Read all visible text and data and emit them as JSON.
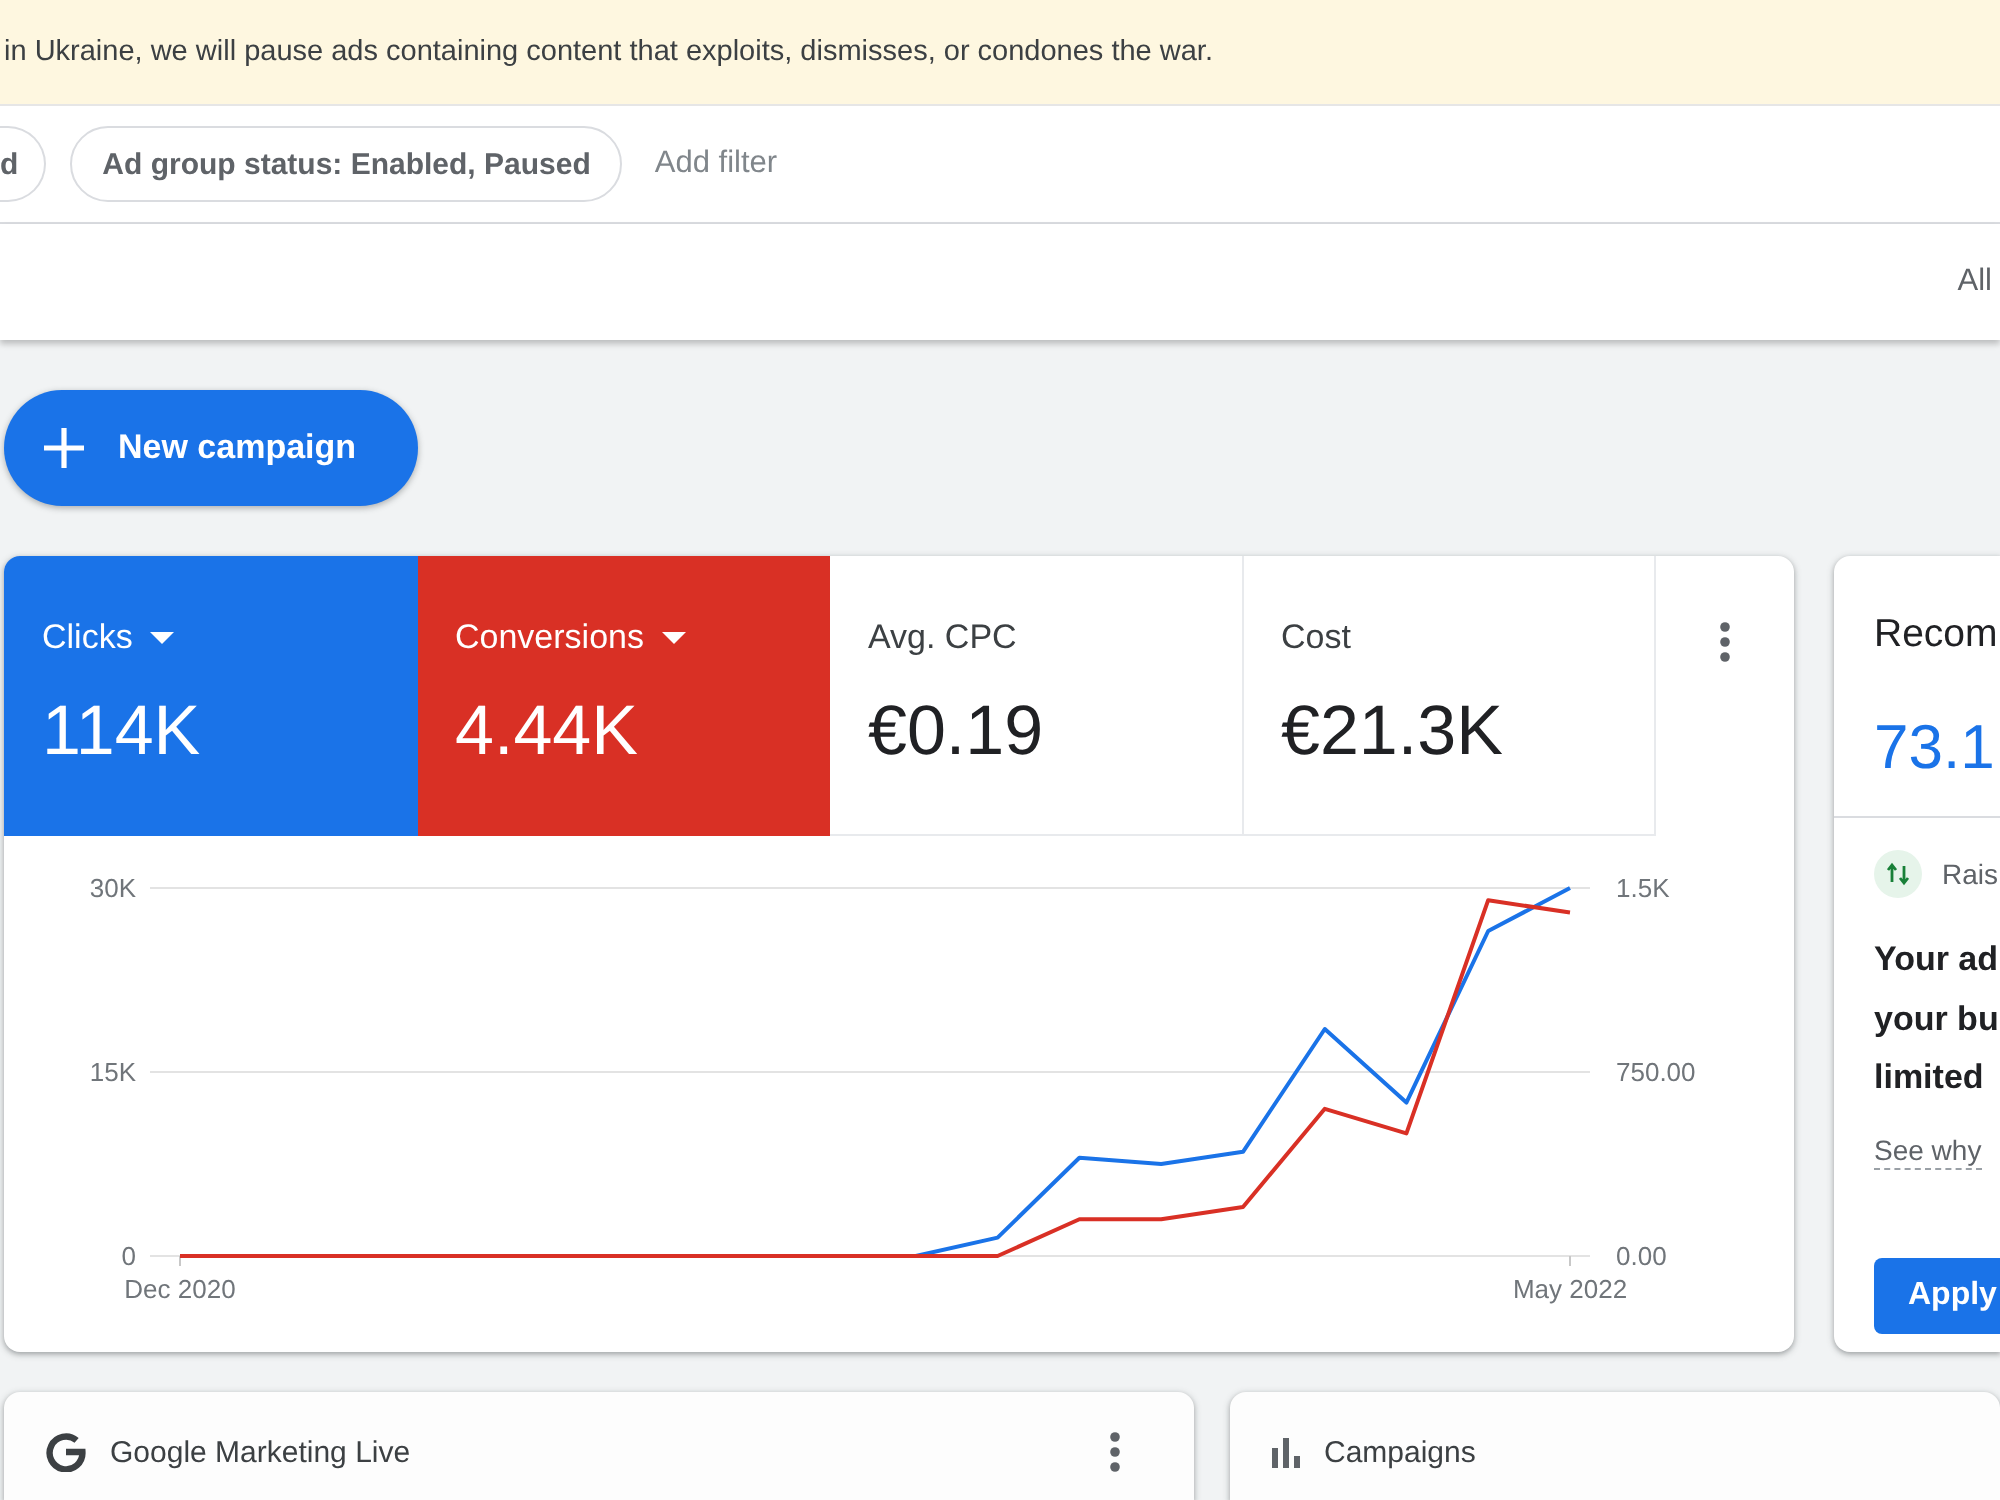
{
  "banner": {
    "text": "in Ukraine, we will pause ads containing content that exploits, dismisses, or condones the war."
  },
  "filters": {
    "chips": [
      "d",
      "Ad group status: Enabled, Paused"
    ],
    "add_filter": "Add filter"
  },
  "toolbar": {
    "view_label": "All"
  },
  "new_campaign_button": {
    "label": "New campaign"
  },
  "overview": {
    "metrics": [
      {
        "label": "Clicks",
        "value": "114K",
        "selected": true,
        "color": "#1a73e8"
      },
      {
        "label": "Conversions",
        "value": "4.44K",
        "selected": true,
        "color": "#d93025"
      },
      {
        "label": "Avg. CPC",
        "value": "€0.19",
        "selected": false
      },
      {
        "label": "Cost",
        "value": "€21.3K",
        "selected": false
      }
    ],
    "chart_data": {
      "type": "line",
      "categories": [
        "Dec 2020",
        null,
        null,
        null,
        null,
        null,
        null,
        null,
        null,
        null,
        null,
        null,
        null,
        null,
        null,
        null,
        null,
        "May 2022"
      ],
      "ylim": [
        0,
        30000
      ],
      "yticks": [
        {
          "value": 0,
          "label": "0"
        },
        {
          "value": 15000,
          "label": "15K"
        },
        {
          "value": 30000,
          "label": "30K"
        }
      ],
      "y2lim": [
        0,
        1500
      ],
      "y2ticks": [
        {
          "value": 0,
          "label": "0.00"
        },
        {
          "value": 750,
          "label": "750.00"
        },
        {
          "value": 1500,
          "label": "1.5K"
        }
      ],
      "series": [
        {
          "color": "#1a73e8",
          "values": [
            null,
            null,
            null,
            null,
            null,
            null,
            null,
            null,
            0,
            0,
            1500,
            8000,
            7500,
            8500,
            18500,
            12500,
            26500,
            30000
          ]
        },
        {
          "color": "#d93025",
          "axis": "y2",
          "values": [
            0,
            0,
            0,
            0,
            0,
            0,
            0,
            0,
            0,
            0,
            0,
            150,
            150,
            200,
            600,
            500,
            1450,
            1400
          ]
        }
      ]
    }
  },
  "recommendations": {
    "title": "Recom",
    "score": "73.1",
    "item": {
      "label": "Rais",
      "body": [
        "Your ad",
        "your bu",
        "limited"
      ],
      "link": "See why"
    },
    "apply_button": "Apply"
  },
  "cards": [
    {
      "kind": "google",
      "title": "Google Marketing Live",
      "has_menu": true
    },
    {
      "kind": "chart",
      "title": "Campaigns",
      "has_menu": false
    }
  ]
}
